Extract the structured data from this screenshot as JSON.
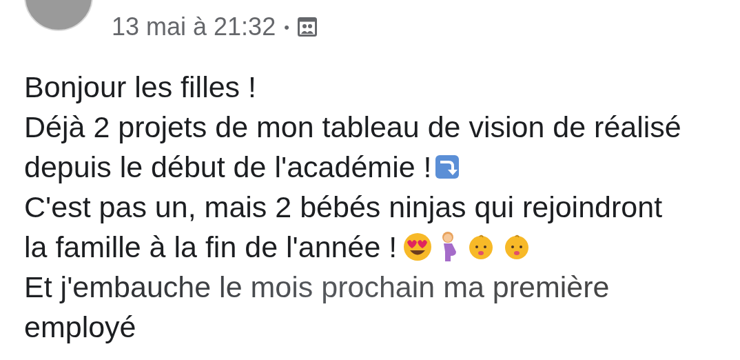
{
  "post": {
    "timestamp": "13 mai à 21:32",
    "separator": "•",
    "lines": [
      {
        "text": "Bonjour les filles !",
        "faded": false
      },
      {
        "text": "Déjà 2 projets de mon tableau de vision de réalisé",
        "faded": false
      },
      {
        "text": "depuis le début de l'académie !",
        "emoji": [
          {
            "kind": "curved-arrow"
          }
        ],
        "faded": false
      },
      {
        "text": "C'est pas un, mais 2 bébés ninjas qui rejoindront",
        "faded": false
      },
      {
        "text": "la famille à la fin de l'année !",
        "emoji": [
          {
            "kind": "heart-eyes"
          },
          {
            "kind": "pregnant-woman"
          },
          {
            "kind": "baby"
          },
          {
            "kind": "baby"
          }
        ],
        "faded": false
      },
      {
        "text": "Et j'embauche le mois prochain ma première",
        "faded": true
      },
      {
        "text": "employé",
        "faded": false
      }
    ]
  }
}
